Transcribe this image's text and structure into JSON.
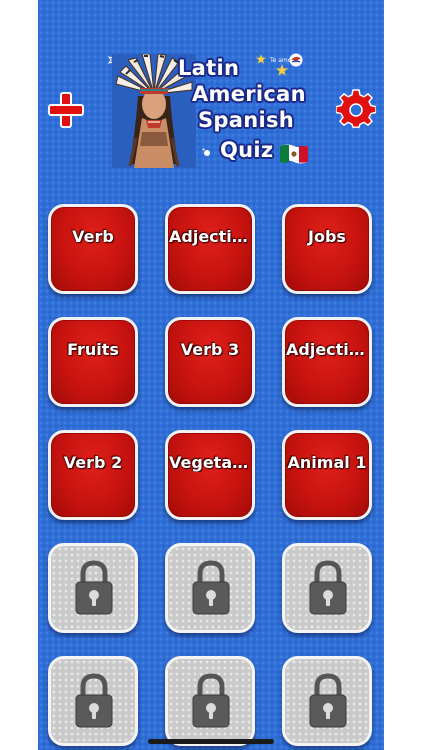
{
  "header": {
    "title_lines": [
      "Latin",
      "American",
      "Spanish",
      "Quiz"
    ],
    "tagline": "Te amo",
    "add_button_icon": "plus-icon",
    "settings_button_icon": "gear-icon"
  },
  "colors": {
    "background": "#2f6fd8",
    "tile_red": "#d0160f",
    "tile_locked": "#c9c9c9",
    "accent_red": "#e01010"
  },
  "categories": [
    {
      "label": "Verb",
      "locked": false
    },
    {
      "label": "Adjectiv...",
      "locked": false
    },
    {
      "label": "Jobs",
      "locked": false
    },
    {
      "label": "Fruits",
      "locked": false
    },
    {
      "label": "Verb 3",
      "locked": false
    },
    {
      "label": "Adjectiv...",
      "locked": false
    },
    {
      "label": "Verb 2",
      "locked": false
    },
    {
      "label": "Vegetabl...",
      "locked": false
    },
    {
      "label": "Animal 1",
      "locked": false
    },
    {
      "label": "",
      "locked": true,
      "icon": "lock-icon"
    },
    {
      "label": "",
      "locked": true,
      "icon": "lock-icon"
    },
    {
      "label": "",
      "locked": true,
      "icon": "lock-icon"
    },
    {
      "label": "",
      "locked": true,
      "icon": "lock-icon"
    },
    {
      "label": "",
      "locked": true,
      "icon": "lock-icon"
    },
    {
      "label": "",
      "locked": true,
      "icon": "lock-icon"
    }
  ]
}
